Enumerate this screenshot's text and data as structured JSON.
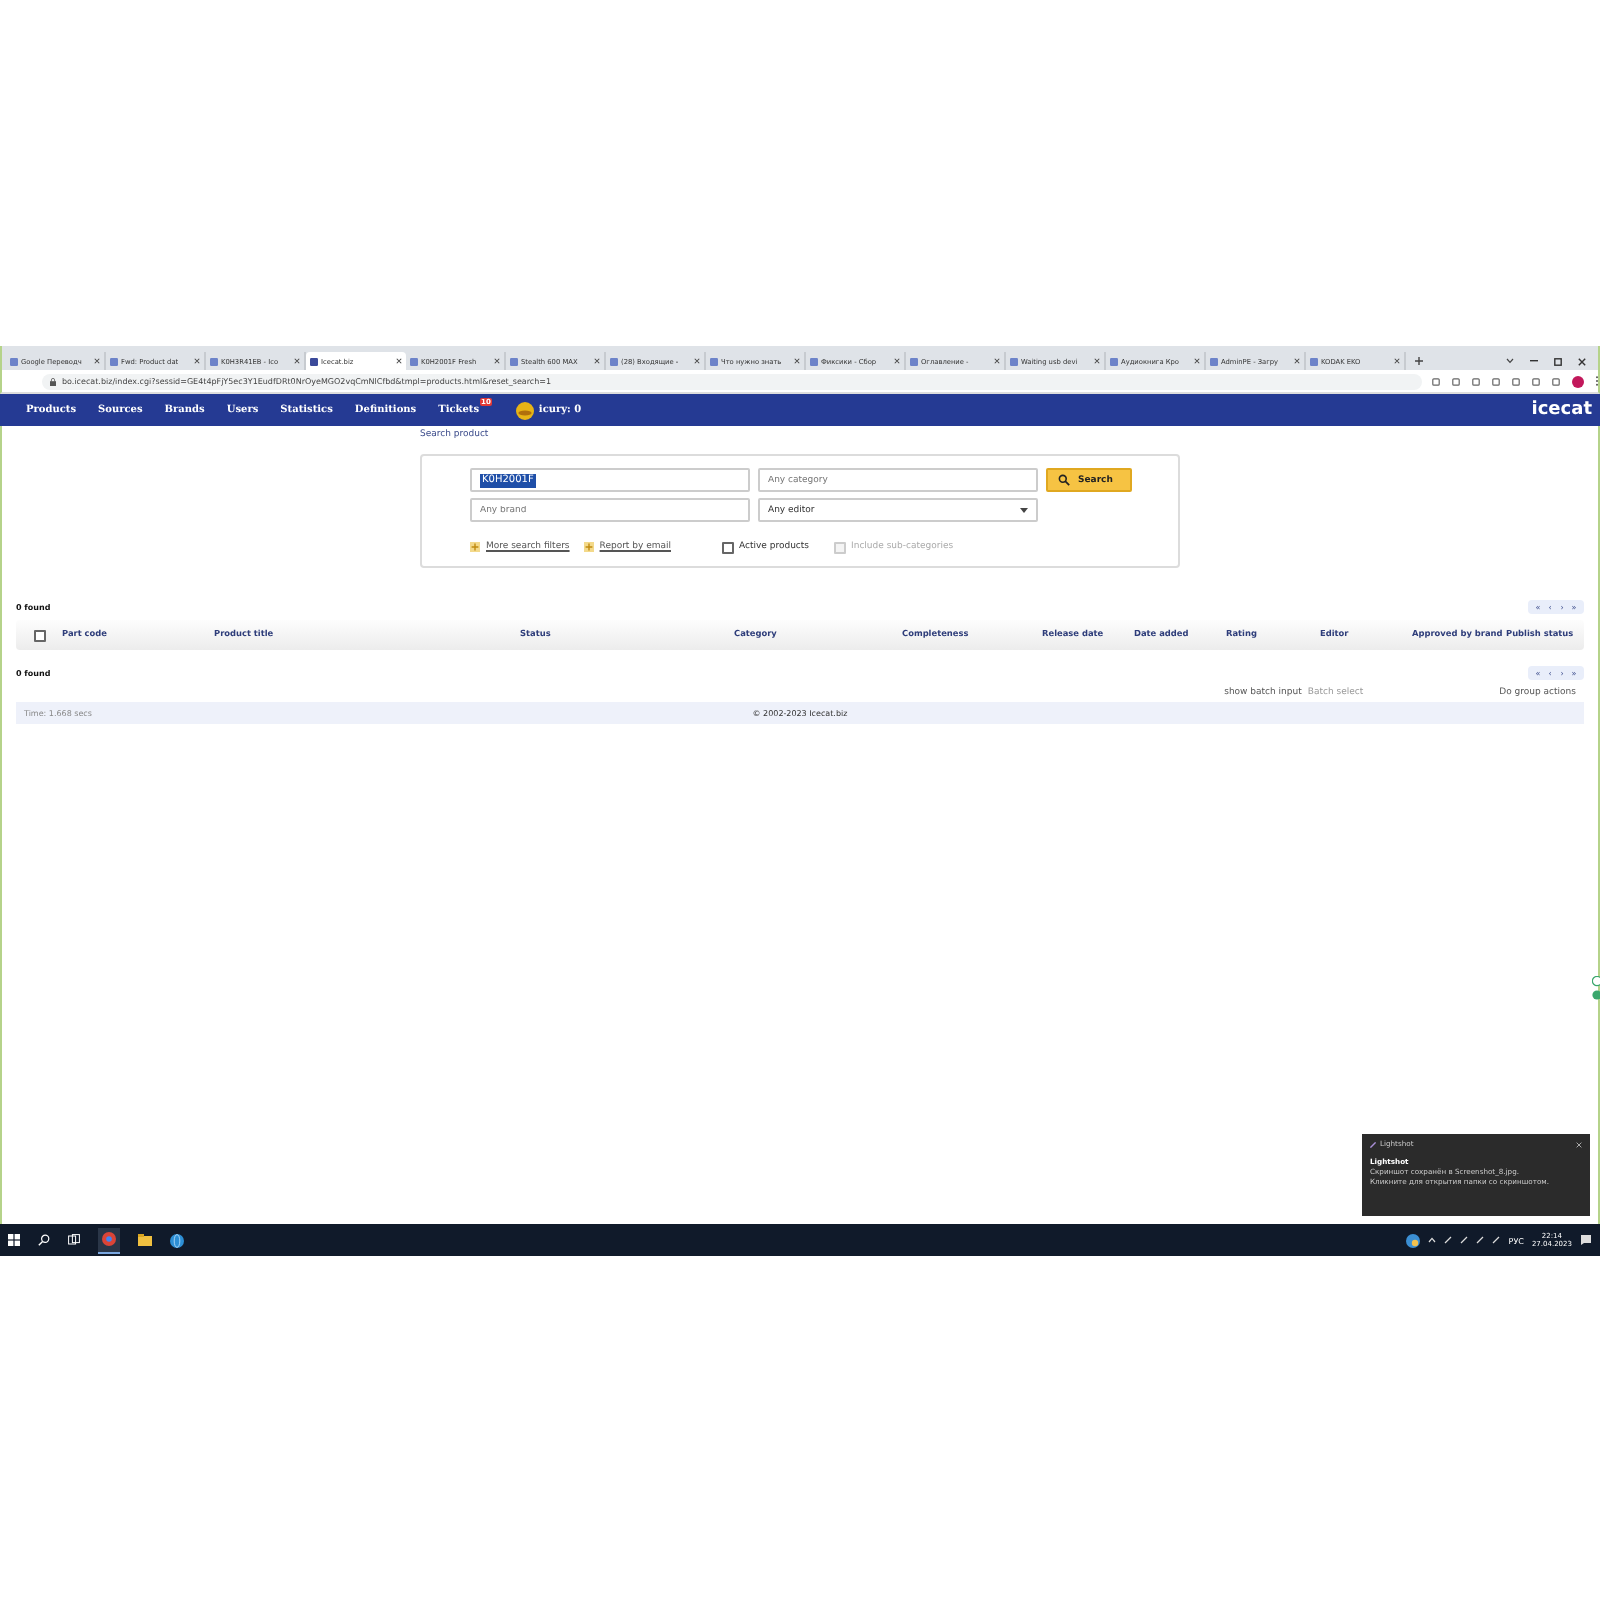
{
  "browser": {
    "tabs": [
      {
        "title": "Google Переводч",
        "selected": false
      },
      {
        "title": "Fwd: Product dat",
        "selected": false
      },
      {
        "title": "K0H3R41EB - Ico",
        "selected": false
      },
      {
        "title": "Icecat.biz",
        "selected": true
      },
      {
        "title": "K0H2001F Fresh",
        "selected": false
      },
      {
        "title": "Stealth 600 MAX",
        "selected": false
      },
      {
        "title": "(28) Входящие -",
        "selected": false
      },
      {
        "title": "Что нужно знать",
        "selected": false
      },
      {
        "title": "Фиксики - Сбор",
        "selected": false
      },
      {
        "title": "Оглавление -",
        "selected": false
      },
      {
        "title": "Waiting usb devi",
        "selected": false
      },
      {
        "title": "Аудиокнига Кро",
        "selected": false
      },
      {
        "title": "AdminPE - Загру",
        "selected": false
      },
      {
        "title": "KODAK EKO",
        "selected": false
      }
    ],
    "url": "bo.icecat.biz/index.cgi?sessid=GE4t4pFjY5ec3Y1EudfDRt0NrOyeMGO2vqCmNlCfbd&tmpl=products.html&reset_search=1"
  },
  "nav": {
    "items": [
      {
        "label": "Products"
      },
      {
        "label": "Sources"
      },
      {
        "label": "Brands"
      },
      {
        "label": "Users"
      },
      {
        "label": "Statistics"
      },
      {
        "label": "Definitions"
      },
      {
        "label": "Tickets",
        "badge": "10"
      }
    ],
    "user": "icury: 0",
    "logo": "icecat"
  },
  "breadcrumb": "Search product",
  "search": {
    "query": "K0H2001F",
    "category_placeholder": "Any category",
    "brand_placeholder": "Any brand",
    "editor": "Any editor",
    "button": "Search",
    "links": [
      "More search filters",
      "Report by email"
    ],
    "checkboxes": [
      {
        "label": "Active products",
        "checked": false,
        "disabled": false
      },
      {
        "label": "Include sub-categories",
        "checked": false,
        "disabled": true
      }
    ]
  },
  "results": {
    "select_all_checked": false,
    "count_top": "0 found",
    "pager_top": [
      "«",
      "‹",
      "›",
      "»"
    ],
    "columns": [
      "Part code",
      "Product title",
      "Status",
      "Category",
      "Completeness",
      "Release date",
      "Date added",
      "Rating",
      "Editor",
      "Approved by brand",
      "Publish status"
    ],
    "count_bottom": "0 found",
    "pager_bottom": [
      "«",
      "‹",
      "›",
      "»"
    ],
    "actions": [
      "show batch input",
      "Batch select",
      "Do group actions"
    ]
  },
  "footer": {
    "time": "Time: 1.668 secs",
    "copyright": "© 2002-2023 Icecat.biz"
  },
  "notification": {
    "app": "Lightshot",
    "title": "Lightshot",
    "lines": [
      "Скриншот сохранён в Screenshot_8.jpg.",
      "Кликните для открытия папки со скриншотом."
    ]
  },
  "taskbar": {
    "language": "РУС",
    "time": "22:14",
    "date": "27.04.2023"
  }
}
